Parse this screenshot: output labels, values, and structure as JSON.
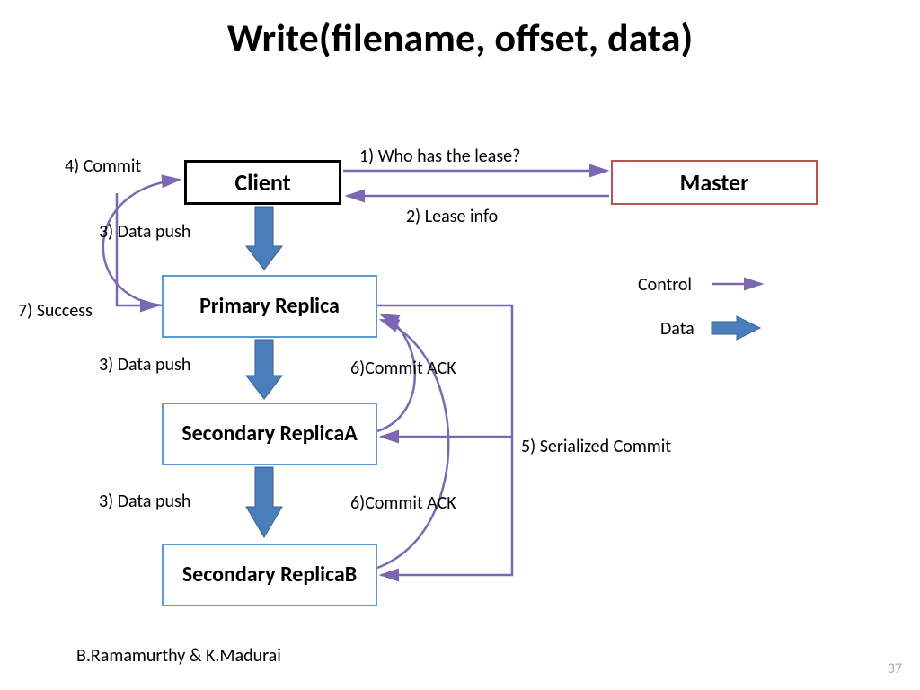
{
  "title": "Write(filename, offset, data)",
  "boxes": {
    "client": "Client",
    "master": "Master",
    "primary": "Primary Replica",
    "secondaryA": "Secondary ReplicaA",
    "secondaryB": "Secondary ReplicaB"
  },
  "labels": {
    "step1": "1) Who has the lease?",
    "step2": "2) Lease info",
    "step3a": "3) Data push",
    "step3b": "3) Data push",
    "step3c": "3) Data push",
    "step4": "4) Commit",
    "step5": "5) Serialized Commit",
    "step6a": "6)Commit ACK",
    "step6b": "6)Commit ACK",
    "step7": "7) Success"
  },
  "legend": {
    "control": "Control",
    "data": "Data"
  },
  "footer": "B.Ramamurthy & K.Madurai",
  "page": "37"
}
